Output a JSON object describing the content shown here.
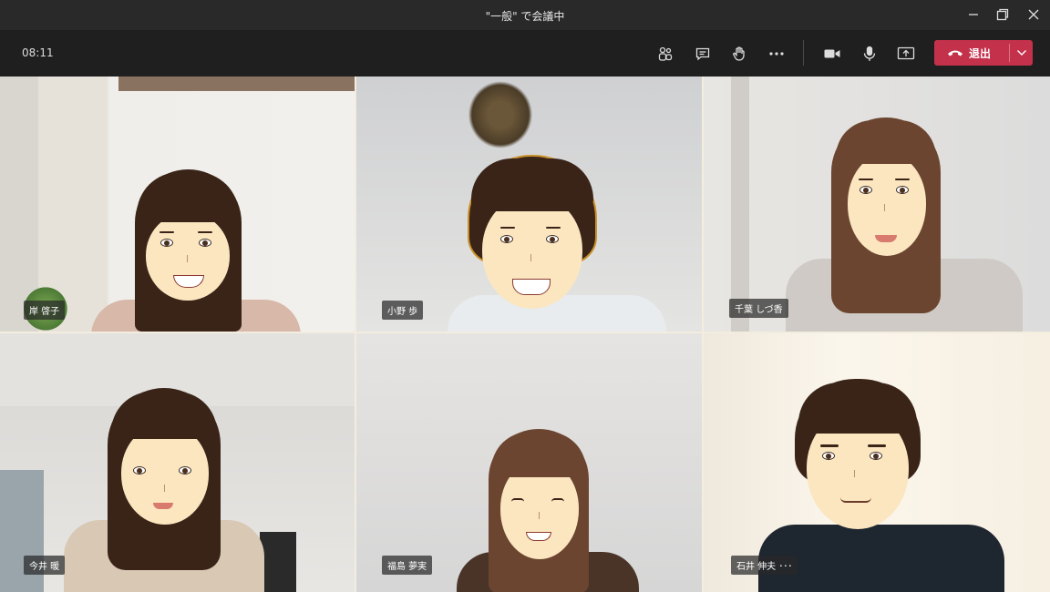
{
  "window": {
    "title": "\"一般\" で会議中",
    "controls": [
      "minimize-icon",
      "restore-icon",
      "close-icon"
    ]
  },
  "callbar": {
    "timer": "08:11",
    "buttons": [
      "participants-icon",
      "chat-icon",
      "raise-hand-icon",
      "more-icon",
      "camera-icon",
      "microphone-icon",
      "share-screen-icon"
    ],
    "leave_label": "退出",
    "leave_color": "#c4314b"
  },
  "participants": [
    {
      "name": "岸 啓子"
    },
    {
      "name": "小野 歩"
    },
    {
      "name": "千葉 しづ香"
    },
    {
      "name": "今井 暖"
    },
    {
      "name": "福島 夢実"
    },
    {
      "name": "石井 伸夫 ･･･"
    }
  ]
}
